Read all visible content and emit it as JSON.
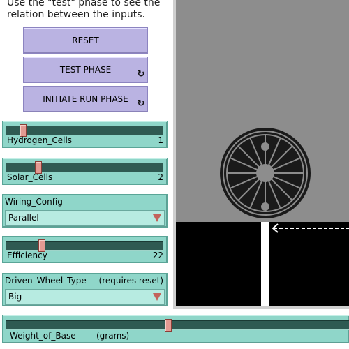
{
  "instructions": {
    "line1": "Use the \"test\" phase to see the",
    "line2": "relation between the inputs."
  },
  "buttons": {
    "reset": "RESET",
    "test_phase": "TEST PHASE",
    "initiate_run": "INITIATE RUN PHASE",
    "forever_glyph": "↻"
  },
  "sliders": {
    "hydrogen": {
      "label": "Hydrogen_Cells",
      "value": "1",
      "fraction": 0.1
    },
    "solar": {
      "label": "Solar_Cells",
      "value": "2",
      "fraction": 0.2
    },
    "efficiency": {
      "label": "Efficiency",
      "value": "22",
      "fraction": 0.22
    },
    "weight": {
      "label": "Weight_of_Base",
      "unit": "(grams)",
      "fraction": 0.47
    }
  },
  "choosers": {
    "wiring": {
      "label": "Wiring_Config",
      "value": "Parallel"
    },
    "wheel": {
      "label": "Driven_Wheel_Type",
      "hint": "(requires reset)",
      "value": "Big"
    }
  },
  "colors": {
    "button": "#bab3e2",
    "widget": "#8fd6c9",
    "view_bg": "#8d8d8d"
  }
}
